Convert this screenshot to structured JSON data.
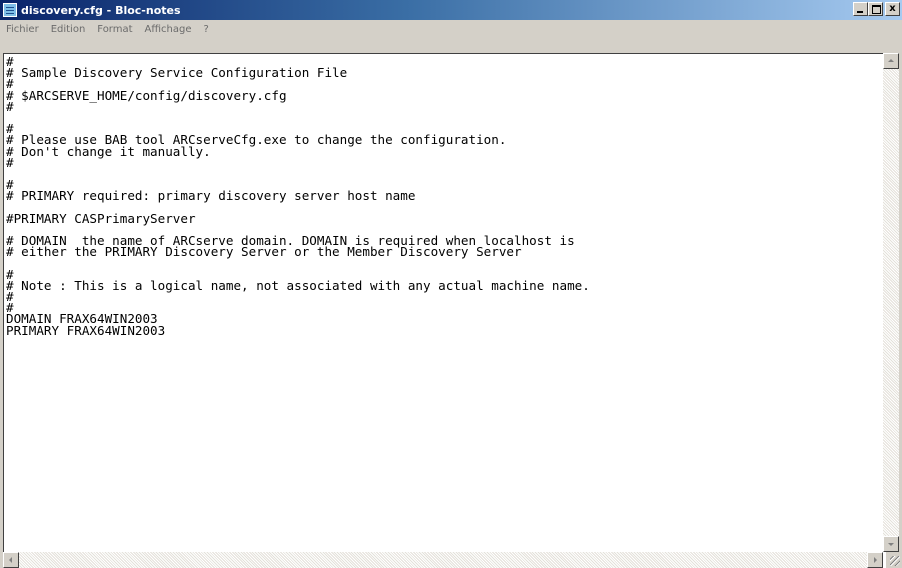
{
  "window": {
    "title": "discovery.cfg - Bloc-notes",
    "icon": "notepad-icon",
    "buttons": {
      "minimize": "_",
      "maximize": "□",
      "close": "x"
    }
  },
  "menu": {
    "items": [
      {
        "label": "Fichier",
        "name": "menu-fichier"
      },
      {
        "label": "Edition",
        "name": "menu-edition"
      },
      {
        "label": "Format",
        "name": "menu-format"
      },
      {
        "label": "Affichage",
        "name": "menu-affichage"
      },
      {
        "label": "?",
        "name": "menu-help"
      }
    ]
  },
  "document": {
    "lines": [
      "#",
      "# Sample Discovery Service Configuration File",
      "#",
      "# $ARCSERVE_HOME/config/discovery.cfg",
      "#",
      "",
      "#",
      "# Please use BAB tool ARCserveCfg.exe to change the configuration.",
      "# Don't change it manually.",
      "#",
      "",
      "#",
      "# PRIMARY required: primary discovery server host name",
      "",
      "#PRIMARY CASPrimaryServer",
      "",
      "# DOMAIN  the name of ARCserve domain. DOMAIN is required when localhost is",
      "# either the PRIMARY Discovery Server or the Member Discovery Server",
      "",
      "#",
      "# Note : This is a logical name, not associated with any actual machine name.",
      "#",
      "#",
      "DOMAIN FRAX64WIN2003",
      "PRIMARY FRAX64WIN2003"
    ]
  }
}
